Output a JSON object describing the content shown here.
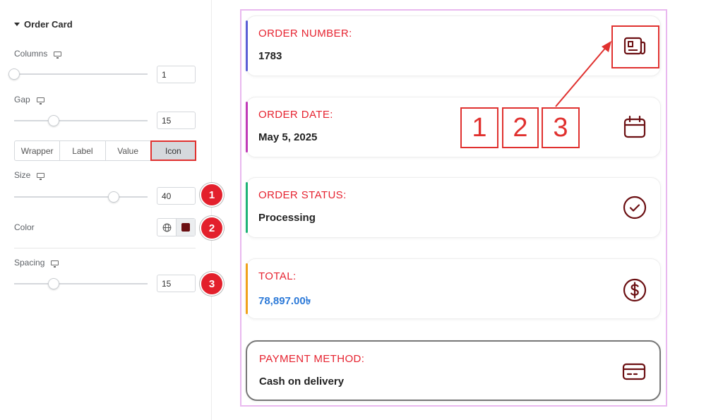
{
  "panel": {
    "section_title": "Order Card",
    "columns": {
      "label": "Columns",
      "value": "1",
      "slider_fraction": 0.0
    },
    "gap": {
      "label": "Gap",
      "value": "15",
      "slider_fraction": 0.3
    },
    "tabs": [
      {
        "label": "Wrapper",
        "active": false
      },
      {
        "label": "Label",
        "active": false
      },
      {
        "label": "Value",
        "active": false
      },
      {
        "label": "Icon",
        "active": true
      }
    ],
    "size": {
      "label": "Size",
      "value": "40",
      "slider_fraction": 0.75
    },
    "color": {
      "label": "Color",
      "swatch": "#6b0f12"
    },
    "spacing": {
      "label": "Spacing",
      "value": "15",
      "slider_fraction": 0.3
    },
    "badges": [
      "1",
      "2",
      "3"
    ]
  },
  "preview": {
    "cards": [
      {
        "label": "ORDER NUMBER:",
        "value": "1783",
        "accent": "#5b5fd6",
        "icon": "receipt-icon"
      },
      {
        "label": "ORDER DATE:",
        "value": "May 5, 2025",
        "accent": "#c13bb8",
        "icon": "calendar-icon"
      },
      {
        "label": "ORDER STATUS:",
        "value": "Processing",
        "accent": "#1fb377",
        "icon": "check-circle-icon"
      },
      {
        "label": "TOTAL:",
        "value": "78,897.00৳",
        "accent": "#f0a21b",
        "icon": "dollar-circle-icon"
      },
      {
        "label": "PAYMENT METHOD:",
        "value": "Cash on delivery",
        "accent": "#777777",
        "icon": "credit-card-icon"
      }
    ],
    "annotation_numbers": [
      "1",
      "2",
      "3"
    ],
    "colors": {
      "label_red": "#e62330",
      "icon_maroon": "#6b0f12",
      "total_blue": "#2d7ad8",
      "highlight_red": "#e0312f"
    }
  }
}
